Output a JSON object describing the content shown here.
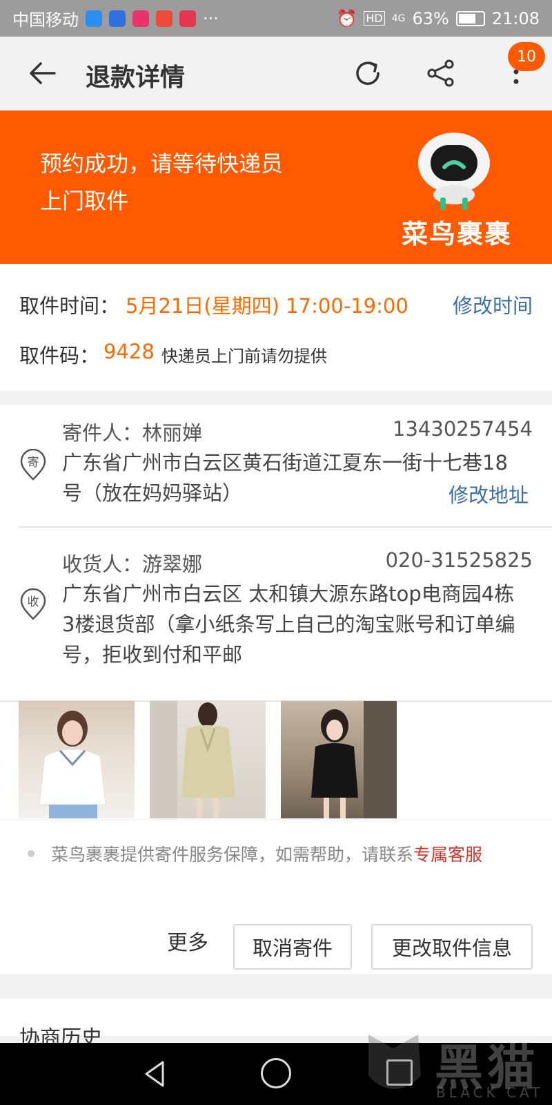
{
  "status_bar": {
    "carrier": "中国移动",
    "battery": "63%",
    "time": "21:08",
    "signal": "4G",
    "hd": "HD",
    "more": "···"
  },
  "toolbar": {
    "title": "退款详情",
    "badge_count": "10"
  },
  "banner": {
    "message": "预约成功，请等待快递员上门取件",
    "brand": "菜鸟裹裹"
  },
  "pickup": {
    "time_label": "取件时间：",
    "time_value": "5月21日(星期四) 17:00-19:00",
    "modify_time": "修改时间",
    "code_label": "取件码：",
    "code_value": "9428",
    "code_note": "快递员上门前请勿提供"
  },
  "sender": {
    "name": "寄件人：林丽婵",
    "phone": "13430257454",
    "address": "广东省广州市白云区黄石街道江夏东一街十七巷18号（放在妈妈驿站）",
    "modify_address": "修改地址",
    "icon_char": "寄"
  },
  "receiver": {
    "name": "收货人：游翠娜",
    "phone": "020-31525825",
    "address": "广东省广州市白云区 太和镇大源东路top电商园4栋3楼退货部（拿小纸条写上自己的淘宝账号和订单编号，拒收到付和平邮",
    "icon_char": "收"
  },
  "products": [
    {
      "name": "product-thumbnail-white-blouse"
    },
    {
      "name": "product-thumbnail-khaki-dress"
    },
    {
      "name": "product-thumbnail-black-dress"
    }
  ],
  "service": {
    "note": "菜鸟裹裹提供寄件服务保障，如需帮助，请联系",
    "link": "专属客服"
  },
  "actions": {
    "more": "更多",
    "cancel": "取消寄件",
    "change": "更改取件信息"
  },
  "history": {
    "title": "协商历史"
  },
  "watermark": {
    "text": "黑猫",
    "sub": "BLACK CAT"
  },
  "colors": {
    "brand_orange": "#ff5a00",
    "link_blue": "#3d6ea8",
    "highlight_orange": "#ff6a00",
    "service_red": "#d6372b"
  }
}
